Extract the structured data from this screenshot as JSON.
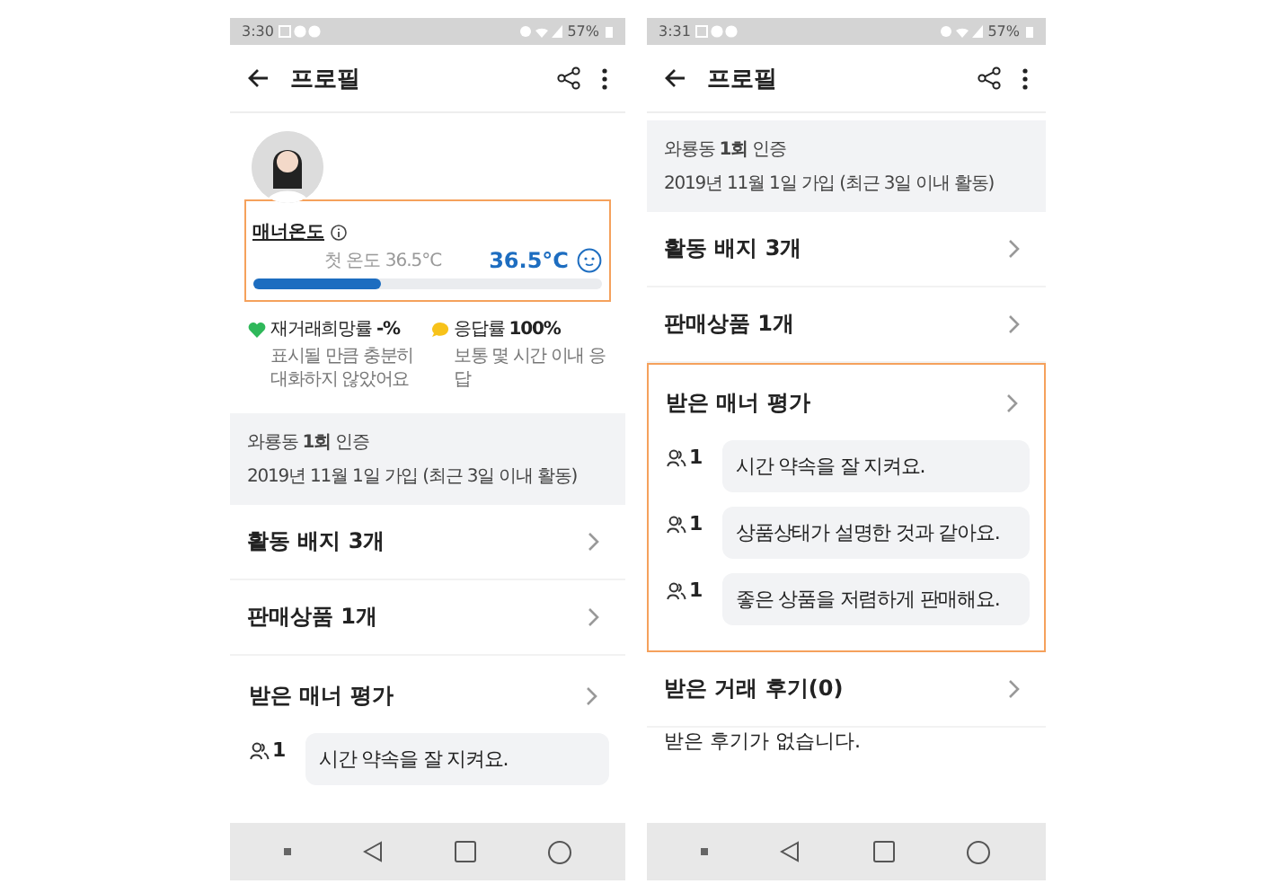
{
  "screens": [
    {
      "status_bar": {
        "time": "3:30",
        "battery": "57%"
      },
      "title": "프로필",
      "blocks": [
        {
          "kind": "profile",
          "temperature": {
            "label": "매너온도",
            "first": "첫 온도 36.5°C",
            "value": "36.5°C",
            "level": 0.37,
            "highlighted": true
          },
          "stats": [
            {
              "kind": "rehire",
              "label": "재거래희망률 **-%**",
              "text": "표시될 만큼 충분히 대화하지 않았어요"
            },
            {
              "kind": "response",
              "label": "응답률 **100%**",
              "text": "보통 몇 시간 이내 응답"
            }
          ]
        },
        {
          "kind": "info",
          "lines": [
            "와룡동 **1회** 인증",
            "2019년 11월 1일 가입 (최근 3일 이내 활동)"
          ]
        },
        {
          "kind": "row",
          "label": "활동 배지 3개"
        },
        {
          "kind": "row",
          "label": "판매상품 1개"
        },
        {
          "kind": "reviews",
          "title": "받은 매너 평가",
          "highlighted": false,
          "items": [
            {
              "count": "1",
              "text": "시간 약속을 잘 지켜요."
            }
          ]
        }
      ]
    },
    {
      "status_bar": {
        "time": "3:31",
        "battery": "57%"
      },
      "title": "프로필",
      "blocks": [
        {
          "kind": "info",
          "lines": [
            "와룡동 **1회** 인증",
            "2019년 11월 1일 가입 (최근 3일 이내 활동)"
          ]
        },
        {
          "kind": "row",
          "label": "활동 배지 3개"
        },
        {
          "kind": "row",
          "label": "판매상품 1개"
        },
        {
          "kind": "reviews",
          "title": "받은 매너 평가",
          "highlighted": true,
          "items": [
            {
              "count": "1",
              "text": "시간 약속을 잘 지켜요."
            },
            {
              "count": "1",
              "text": "상품상태가 설명한 것과 같아요."
            },
            {
              "count": "1",
              "text": "좋은 상품을 저렴하게 판매해요."
            }
          ]
        },
        {
          "kind": "row",
          "label": "받은 거래 후기(0)"
        },
        {
          "kind": "note",
          "text": "받은 후기가 없습니다."
        }
      ]
    }
  ]
}
